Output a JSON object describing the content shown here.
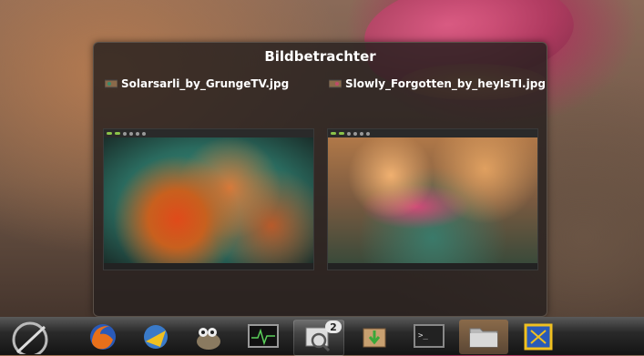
{
  "window": {
    "title": "Bildbetrachter"
  },
  "thumbnails": [
    {
      "filename": "Solarsarli_by_GrungeTV.jpg"
    },
    {
      "filename": "Slowly_Forgotten_by_heyIsTI.jpg"
    }
  ],
  "taskbar": {
    "items": [
      {
        "icon": "start-icon"
      },
      {
        "icon": "firefox-icon"
      },
      {
        "icon": "network-icon"
      },
      {
        "icon": "gimp-icon"
      },
      {
        "icon": "system-monitor-icon"
      },
      {
        "icon": "image-viewer-icon",
        "badge": "2"
      },
      {
        "icon": "package-installer-icon"
      },
      {
        "icon": "terminal-icon"
      },
      {
        "icon": "file-manager-icon"
      },
      {
        "icon": "virtualbox-icon"
      }
    ]
  }
}
